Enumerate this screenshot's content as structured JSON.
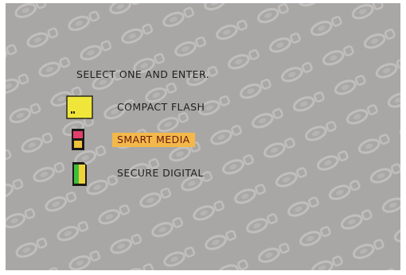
{
  "prompt": "SELECT ONE AND ENTER.",
  "menu": {
    "items": [
      {
        "label": "COMPACT FLASH",
        "icon": "compact-flash-card-icon",
        "selected": false
      },
      {
        "label": "SMART MEDIA",
        "icon": "smart-media-card-icon",
        "selected": true
      },
      {
        "label": "SECURE DIGITAL",
        "icon": "secure-digital-card-icon",
        "selected": false
      }
    ]
  },
  "colors": {
    "background": "#a9a7a5",
    "highlight": "#f3b84a",
    "highlight_text": "#6a1a10",
    "text": "#1f1f22"
  }
}
